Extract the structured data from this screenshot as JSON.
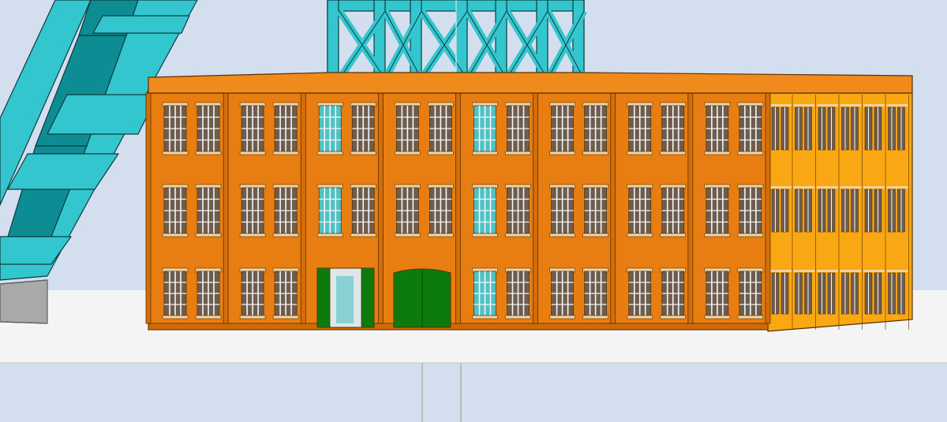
{
  "colors": {
    "sky": "#d3deee",
    "ground": "#f4f4f4",
    "ground_edge": "#c8c8c8",
    "front_facade": "#e87d12",
    "side_facade": "#f9a814",
    "roof": "#f08a1c",
    "outline": "#5a3000",
    "window_frame": "#f2d2a0",
    "window_glass": "#6d5d4f",
    "window_glass_alt": "#4ec2c4",
    "window_bar": "#f5f5f5",
    "door_green": "#0c7a0c",
    "door_green_dark": "#065806",
    "steel": "#34c6cf",
    "steel_dark": "#0e8c93",
    "steel_outline": "#0d3c3f",
    "concrete": "#a9a9a9"
  },
  "scene": {
    "view": "3D model render",
    "building": {
      "floors": 3,
      "front_bays": 8,
      "windows_per_bay": 2,
      "side_bays": 6,
      "doors": [
        "open-green-door",
        "large-green-double-door"
      ]
    },
    "headframe": "steel-lattice-tower",
    "crane_arm": "diagonal-steel-truss"
  }
}
